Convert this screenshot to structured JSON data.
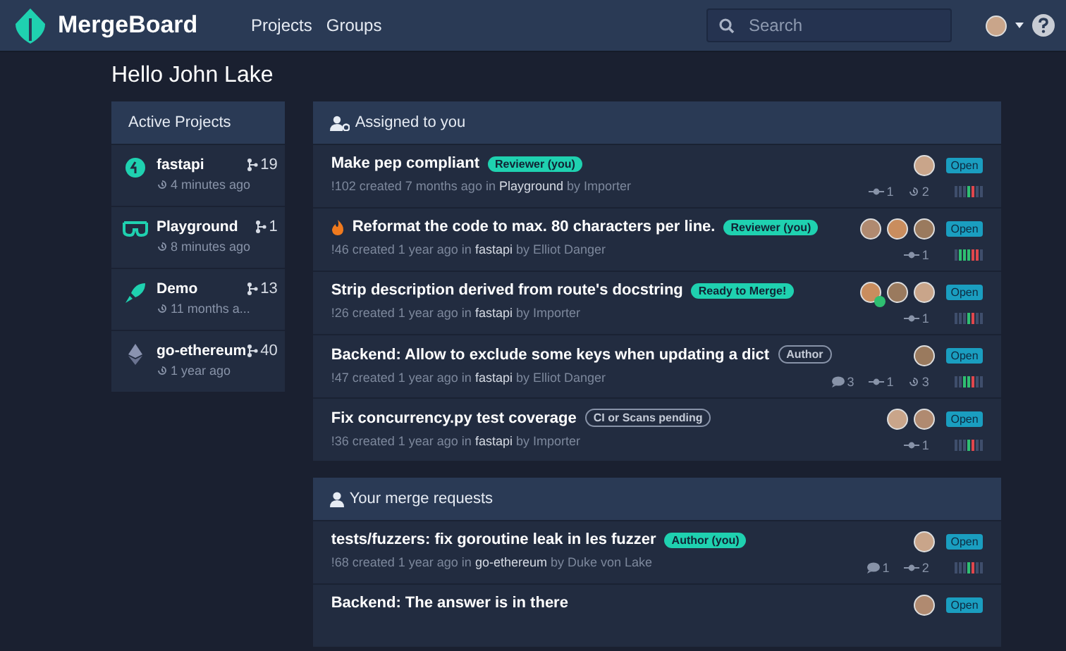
{
  "brand": {
    "name": "MergeBoard"
  },
  "nav": [
    {
      "label": "Projects"
    },
    {
      "label": "Groups"
    }
  ],
  "search": {
    "placeholder": "Search"
  },
  "greeting": "Hello John Lake",
  "projects": {
    "title": "Active Projects",
    "items": [
      {
        "name": "fastapi",
        "kind": "circle",
        "count": "19",
        "time": "4 minutes ago"
      },
      {
        "name": "Playground",
        "kind": "glasses",
        "count": "1",
        "time": "8 minutes ago"
      },
      {
        "name": "Demo",
        "kind": "rocket",
        "count": "13",
        "time": "11 months a..."
      },
      {
        "name": "go-ethereum",
        "kind": "diamond",
        "count": "40",
        "time": "1 year ago"
      }
    ]
  },
  "sections": [
    {
      "title": "Assigned to you",
      "kind": "assigned",
      "requests": [
        {
          "title": "Make pep compliant",
          "tag": {
            "text": "Reviewer (you)",
            "kind": "solid"
          },
          "id": "!102",
          "created": "created 7 months ago in",
          "project": "Playground",
          "by": "by Importer",
          "reviewers": [
            {
              "approved": false
            }
          ],
          "status": "Open",
          "stats": [
            {
              "kind": "commits",
              "value": "1"
            },
            {
              "kind": "history",
              "value": "2"
            }
          ]
        },
        {
          "title": "Reformat the code to max. 80 characters per line.",
          "fire": true,
          "tag": {
            "text": "Reviewer (you)",
            "kind": "solid"
          },
          "id": "!46",
          "created": "created 1 year ago in",
          "project": "fastapi",
          "by": "by Elliot Danger",
          "reviewers": [
            {
              "approved": false
            },
            {
              "approved": false
            },
            {
              "approved": false
            }
          ],
          "status": "Open",
          "stats": [
            {
              "kind": "commits",
              "value": "1"
            }
          ]
        },
        {
          "title": "Strip description derived from route's docstring",
          "tag": {
            "text": "Ready to Merge!",
            "kind": "solid"
          },
          "id": "!26",
          "created": "created 1 year ago in",
          "project": "fastapi",
          "by": "by Importer",
          "reviewers": [
            {
              "approved": true
            },
            {
              "approved": false
            },
            {
              "approved": false
            }
          ],
          "status": "Open",
          "stats": [
            {
              "kind": "commits",
              "value": "1"
            }
          ]
        },
        {
          "title": "Backend: Allow to exclude some keys when updating a dict",
          "tag": {
            "text": "Author",
            "kind": "outline"
          },
          "id": "!47",
          "created": "created 1 year ago in",
          "project": "fastapi",
          "by": "by Elliot Danger",
          "reviewers": [
            {
              "approved": false
            }
          ],
          "status": "Open",
          "stats": [
            {
              "kind": "comments",
              "value": "3"
            },
            {
              "kind": "commits",
              "value": "1"
            },
            {
              "kind": "history",
              "value": "3"
            }
          ]
        },
        {
          "title": "Fix concurrency.py test coverage",
          "tag": {
            "text": "CI or Scans pending",
            "kind": "outline"
          },
          "id": "!36",
          "created": "created 1 year ago in",
          "project": "fastapi",
          "by": "by Importer",
          "reviewers": [
            {
              "approved": false
            },
            {
              "approved": false
            }
          ],
          "status": "Open",
          "stats": [
            {
              "kind": "commits",
              "value": "1"
            }
          ]
        }
      ]
    },
    {
      "title": "Your merge requests",
      "kind": "own",
      "requests": [
        {
          "title": "tests/fuzzers: fix goroutine leak in les fuzzer",
          "tag": {
            "text": "Author (you)",
            "kind": "solid"
          },
          "id": "!68",
          "created": "created 1 year ago in",
          "project": "go-ethereum",
          "by": "by Duke von Lake",
          "reviewers": [
            {
              "approved": false
            }
          ],
          "status": "Open",
          "stats": [
            {
              "kind": "comments",
              "value": "1"
            },
            {
              "kind": "commits",
              "value": "2"
            }
          ]
        },
        {
          "title": "Backend: The answer is in there",
          "reviewers": [
            {
              "approved": false
            }
          ],
          "status": "Open"
        }
      ]
    }
  ]
}
